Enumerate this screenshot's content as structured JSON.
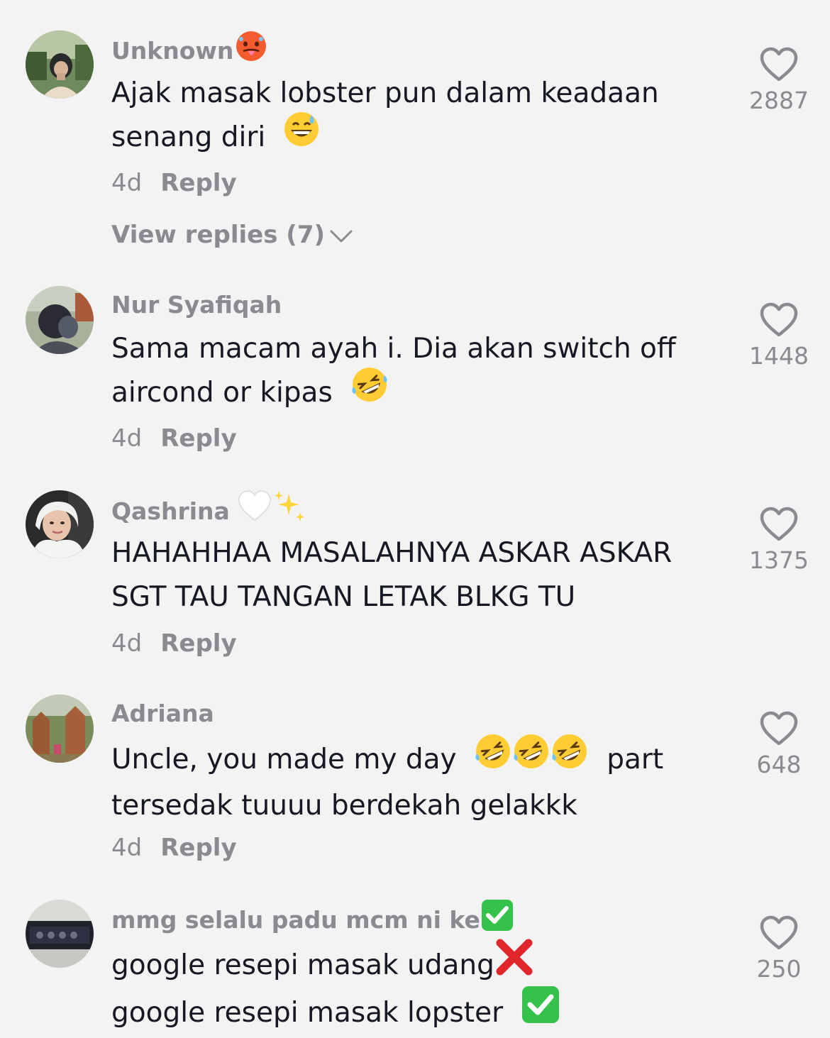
{
  "comments": [
    {
      "username": "Unknown",
      "username_emoji": "hot-face-icon",
      "lines": [
        "Ajak masak lobster pun dalam keadaan",
        "senang diri"
      ],
      "line_emojis": [
        "",
        "grinning-sweat-icon"
      ],
      "age": "4d",
      "reply_label": "Reply",
      "view_replies": "View replies (7)",
      "likes": "2887"
    },
    {
      "username": "Nur Syafiqah",
      "lines": [
        "Sama macam ayah i. Dia akan switch off",
        "aircond or kipas"
      ],
      "line_emojis": [
        "",
        "rofl-icon"
      ],
      "age": "4d",
      "reply_label": "Reply",
      "likes": "1448"
    },
    {
      "username": "Qashrina",
      "username_emoji": "white-heart-sparkles-icon",
      "lines": [
        "HAHAHHAA MASALAHNYA ASKAR ASKAR",
        "SGT TAU TANGAN LETAK BLKG TU"
      ],
      "age": "4d",
      "reply_label": "Reply",
      "likes": "1375"
    },
    {
      "username": "Adriana",
      "lines": [
        "Uncle, you made my day",
        "part",
        "tersedak tuuuu berdekah gelakkk"
      ],
      "age": "4d",
      "reply_label": "Reply",
      "likes": "648"
    },
    {
      "username": "mmg selalu padu mcm ni ke",
      "username_emoji": "check-mark-button-icon",
      "lines": [
        "google resepi masak udang",
        "google resepi masak lopster"
      ],
      "line_emojis": [
        "cross-mark-icon",
        "check-mark-button-icon"
      ],
      "likes": "250"
    }
  ],
  "colors": {
    "background": "#f3f3f3",
    "primary_text": "#161823",
    "secondary_text": "#8a8b91"
  }
}
